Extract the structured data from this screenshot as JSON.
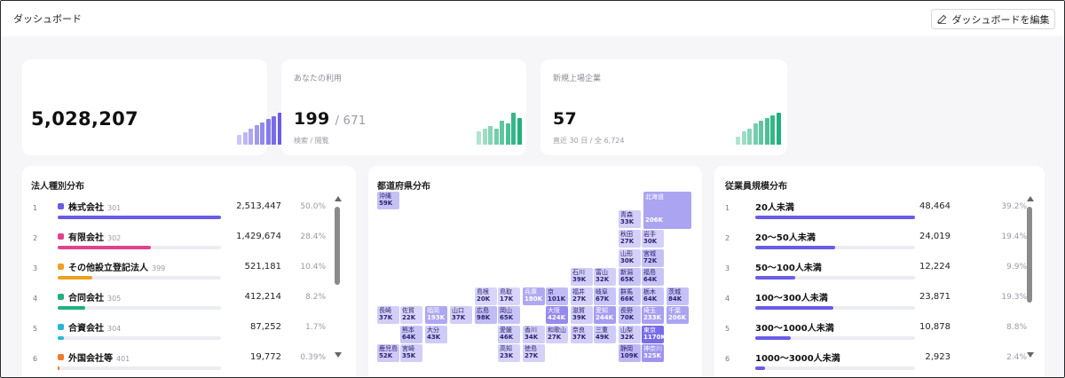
{
  "header": {
    "title": "ダッシュボード",
    "edit_button": "ダッシュボードを編集"
  },
  "kpis": [
    {
      "label": "",
      "value": "5,028,207",
      "denom": "",
      "sub": "",
      "spark": [
        3,
        4,
        5,
        6,
        7,
        8,
        9,
        10
      ],
      "color": "#6a5ce6"
    },
    {
      "label": "あなたの利用",
      "value": "199",
      "denom": "/ 671",
      "sub": "検索 / 閲覧",
      "spark": [
        5,
        6,
        7,
        6,
        9,
        8,
        12,
        10
      ],
      "color": "#22b07d"
    },
    {
      "label": "新規上場企業",
      "value": "57",
      "denom": "",
      "sub": "直近 30 日 / 全 6,724",
      "spark": [
        3,
        5,
        6,
        8,
        9,
        10,
        11,
        12
      ],
      "color": "#22b07d"
    }
  ],
  "corp_types": {
    "title": "法人種別分布",
    "rows": [
      {
        "idx": "1",
        "label": "株式会社",
        "code": "301",
        "value": "2,513,447",
        "pct": "50.0%",
        "frac": 1.0,
        "color": "#6a5ce6"
      },
      {
        "idx": "2",
        "label": "有限会社",
        "code": "302",
        "value": "1,429,674",
        "pct": "28.4%",
        "frac": 0.57,
        "color": "#e0438c"
      },
      {
        "idx": "3",
        "label": "その他設立登記法人",
        "code": "399",
        "value": "521,181",
        "pct": "10.4%",
        "frac": 0.21,
        "color": "#f0a020"
      },
      {
        "idx": "4",
        "label": "合同会社",
        "code": "305",
        "value": "412,214",
        "pct": "8.2%",
        "frac": 0.17,
        "color": "#22b07d"
      },
      {
        "idx": "5",
        "label": "合資会社",
        "code": "304",
        "value": "87,252",
        "pct": "1.7%",
        "frac": 0.04,
        "color": "#28b6d4"
      },
      {
        "idx": "6",
        "label": "外国会社等",
        "code": "401",
        "value": "19,772",
        "pct": "0.39%",
        "frac": 0.01,
        "color": "#f07a28"
      }
    ]
  },
  "prefectures": {
    "title": "都道府県分布",
    "cells": [
      {
        "name": "北海道",
        "value": "206K",
        "intensity": 0.55
      },
      {
        "name": "沖縄",
        "value": "59K",
        "intensity": 0.3
      },
      {
        "name": "青森",
        "value": "33K",
        "intensity": 0.2
      },
      {
        "name": "秋田",
        "value": "27K",
        "intensity": 0.18
      },
      {
        "name": "岩手",
        "value": "30K",
        "intensity": 0.18
      },
      {
        "name": "山形",
        "value": "30K",
        "intensity": 0.18
      },
      {
        "name": "宮城",
        "value": "72K",
        "intensity": 0.3
      },
      {
        "name": "石川",
        "value": "39K",
        "intensity": 0.2
      },
      {
        "name": "富山",
        "value": "32K",
        "intensity": 0.2
      },
      {
        "name": "新潟",
        "value": "65K",
        "intensity": 0.28
      },
      {
        "name": "福島",
        "value": "64K",
        "intensity": 0.28
      },
      {
        "name": "島根",
        "value": "20K",
        "intensity": 0.15
      },
      {
        "name": "鳥取",
        "value": "17K",
        "intensity": 0.15
      },
      {
        "name": "兵庫",
        "value": "180K",
        "intensity": 0.5
      },
      {
        "name": "京",
        "value": "101K",
        "intensity": 0.35
      },
      {
        "name": "福井",
        "value": "27K",
        "intensity": 0.18
      },
      {
        "name": "岐阜",
        "value": "67K",
        "intensity": 0.28
      },
      {
        "name": "群馬",
        "value": "66K",
        "intensity": 0.28
      },
      {
        "name": "栃木",
        "value": "64K",
        "intensity": 0.28
      },
      {
        "name": "茨城",
        "value": "84K",
        "intensity": 0.32
      },
      {
        "name": "長崎",
        "value": "37K",
        "intensity": 0.2
      },
      {
        "name": "佐賀",
        "value": "22K",
        "intensity": 0.15
      },
      {
        "name": "福岡",
        "value": "193K",
        "intensity": 0.52
      },
      {
        "name": "山口",
        "value": "37K",
        "intensity": 0.2
      },
      {
        "name": "広島",
        "value": "98K",
        "intensity": 0.35
      },
      {
        "name": "岡山",
        "value": "65K",
        "intensity": 0.28
      },
      {
        "name": "大阪",
        "value": "424K",
        "intensity": 0.75
      },
      {
        "name": "滋賀",
        "value": "39K",
        "intensity": 0.2
      },
      {
        "name": "愛知",
        "value": "244K",
        "intensity": 0.6
      },
      {
        "name": "長野",
        "value": "70K",
        "intensity": 0.3
      },
      {
        "name": "埼玉",
        "value": "233K",
        "intensity": 0.58
      },
      {
        "name": "千葉",
        "value": "206K",
        "intensity": 0.55
      },
      {
        "name": "熊本",
        "value": "64K",
        "intensity": 0.28
      },
      {
        "name": "大分",
        "value": "43K",
        "intensity": 0.22
      },
      {
        "name": "愛媛",
        "value": "46K",
        "intensity": 0.22
      },
      {
        "name": "香川",
        "value": "34K",
        "intensity": 0.2
      },
      {
        "name": "和歌山",
        "value": "27K",
        "intensity": 0.18
      },
      {
        "name": "奈良",
        "value": "37K",
        "intensity": 0.2
      },
      {
        "name": "三重",
        "value": "49K",
        "intensity": 0.22
      },
      {
        "name": "山梨",
        "value": "32K",
        "intensity": 0.2
      },
      {
        "name": "東京",
        "value": "1170K",
        "intensity": 1.0
      },
      {
        "name": "鹿児島",
        "value": "52K",
        "intensity": 0.24
      },
      {
        "name": "宮崎",
        "value": "35K",
        "intensity": 0.2
      },
      {
        "name": "高知",
        "value": "23K",
        "intensity": 0.16
      },
      {
        "name": "徳島",
        "value": "27K",
        "intensity": 0.18
      },
      {
        "name": "静岡",
        "value": "109K",
        "intensity": 0.38
      },
      {
        "name": "神奈川",
        "value": "325K",
        "intensity": 0.68
      }
    ]
  },
  "employees": {
    "title": "従業員規模分布",
    "rows": [
      {
        "idx": "1",
        "label": "20人未満",
        "value": "48,464",
        "pct": "39.2%",
        "frac": 1.0
      },
      {
        "idx": "2",
        "label": "20〜50人未満",
        "value": "24,019",
        "pct": "19.4%",
        "frac": 0.5
      },
      {
        "idx": "3",
        "label": "50〜100人未満",
        "value": "12,224",
        "pct": "9.9%",
        "frac": 0.25
      },
      {
        "idx": "4",
        "label": "100〜300人未満",
        "value": "23,871",
        "pct": "19.3%",
        "frac": 0.49
      },
      {
        "idx": "5",
        "label": "300〜1000人未満",
        "value": "10,878",
        "pct": "8.8%",
        "frac": 0.22
      },
      {
        "idx": "6",
        "label": "1000〜3000人未満",
        "value": "2,923",
        "pct": "2.4%",
        "frac": 0.06
      }
    ]
  },
  "colors": {
    "accent": "#6a5ce6",
    "green": "#22b07d",
    "map_base": "#6a5ce6"
  }
}
